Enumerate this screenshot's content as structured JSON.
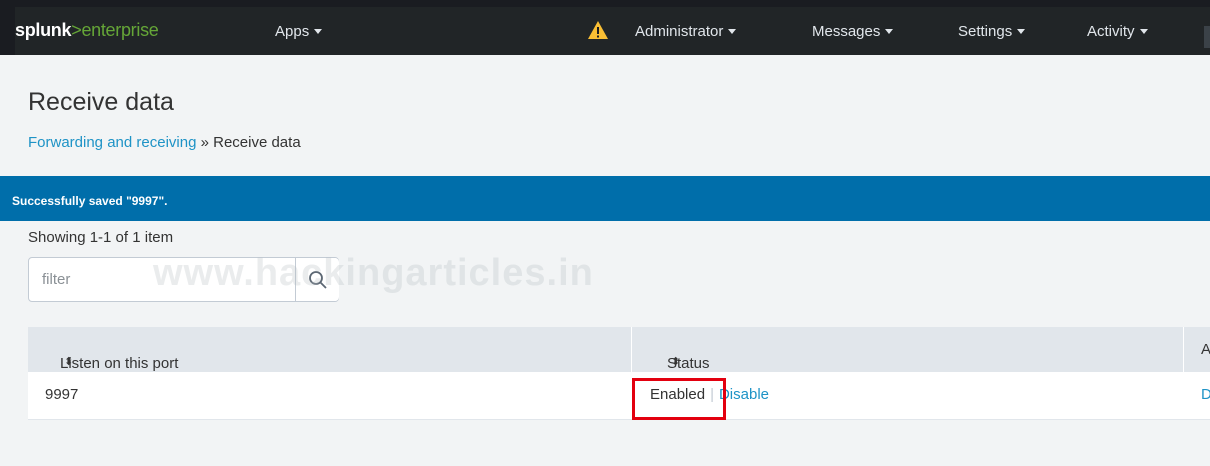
{
  "header": {
    "logo_brand": "splunk",
    "logo_gt": ">",
    "logo_product": "enterprise",
    "apps": "Apps",
    "administrator": "Administrator",
    "messages": "Messages",
    "settings": "Settings",
    "activity": "Activity"
  },
  "page": {
    "title": "Receive data",
    "breadcrumb_link": "Forwarding and receiving",
    "breadcrumb_sep": " » ",
    "breadcrumb_current": "Receive data"
  },
  "banner": {
    "message": "Successfully saved \"9997\"."
  },
  "list": {
    "count": "Showing 1-1 of 1 item",
    "filter_placeholder": "filter"
  },
  "watermark": "www.hackingarticles.in",
  "table": {
    "headers": [
      "Listen on this port",
      "Status",
      "A"
    ],
    "sort_glyph": "⬍",
    "rows": [
      {
        "port": "9997",
        "status": "Enabled",
        "sep": "|",
        "action": "Disable",
        "extra": "D"
      }
    ]
  },
  "colors": {
    "banner": "#006eaa",
    "link": "#1e93c6",
    "brand_green": "#65a637",
    "highlight": "#e3000f"
  }
}
